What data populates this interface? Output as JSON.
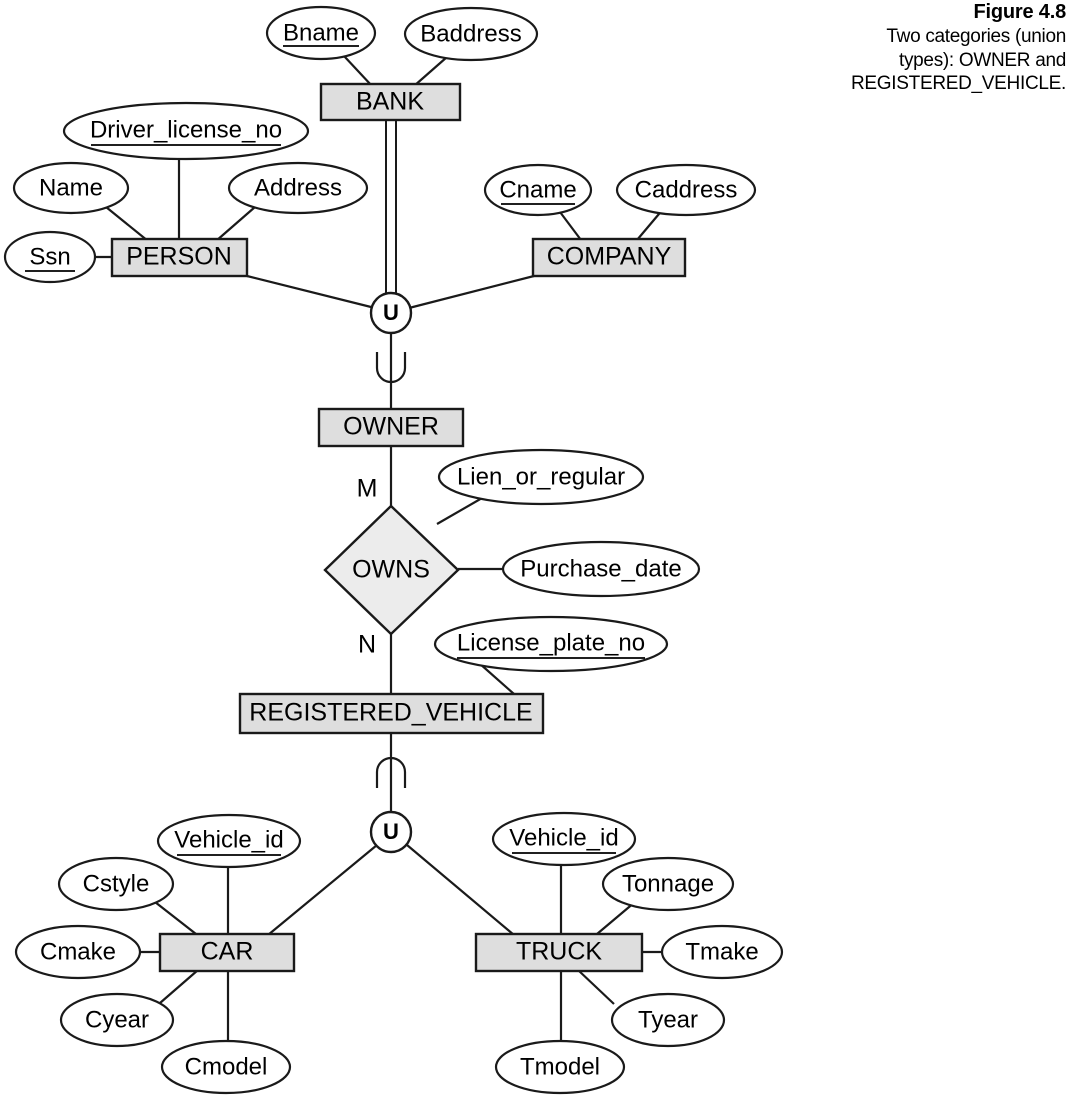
{
  "caption": {
    "figure_number": "Figure 4.8",
    "line1": "Two categories (union",
    "line2": "types): OWNER and",
    "line3": "REGISTERED_VEHICLE."
  },
  "entities": {
    "bank": "BANK",
    "person": "PERSON",
    "company": "COMPANY",
    "owner": "OWNER",
    "registered_vehicle": "REGISTERED_VEHICLE",
    "car": "CAR",
    "truck": "TRUCK"
  },
  "relationships": {
    "owns": "OWNS"
  },
  "cardinalities": {
    "owner_side": "M",
    "vehicle_side": "N"
  },
  "union_symbols": {
    "upper": "U",
    "lower": "U"
  },
  "attributes": {
    "bname": "Bname",
    "baddress": "Baddress",
    "driver_license_no": "Driver_license_no",
    "name": "Name",
    "address": "Address",
    "ssn": "Ssn",
    "cname": "Cname",
    "caddress": "Caddress",
    "lien_or_regular": "Lien_or_regular",
    "purchase_date": "Purchase_date",
    "license_plate_no": "License_plate_no",
    "car_vehicle_id": "Vehicle_id",
    "cstyle": "Cstyle",
    "cmake": "Cmake",
    "cyear": "Cyear",
    "cmodel": "Cmodel",
    "truck_vehicle_id": "Vehicle_id",
    "tonnage": "Tonnage",
    "tmake": "Tmake",
    "tyear": "Tyear",
    "tmodel": "Tmodel"
  },
  "colors": {
    "entity_fill": "#dedede",
    "relationship_fill": "#ececec",
    "stroke": "#1a1a1a",
    "background": "#ffffff"
  }
}
